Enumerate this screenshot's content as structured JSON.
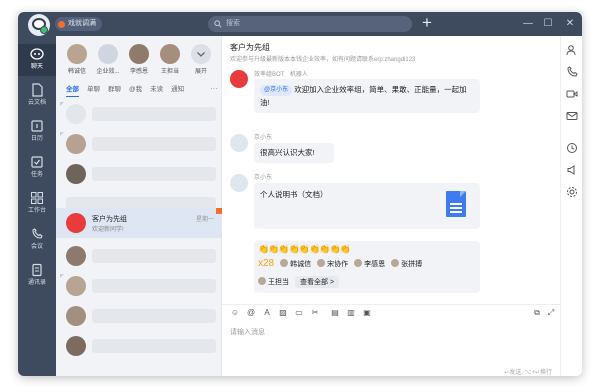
{
  "titlebar": {
    "status_label": "戏就调满",
    "search_placeholder": "搜索",
    "add_label": "+",
    "minimize": "—",
    "maximize": "☐",
    "close": "✕"
  },
  "rail": [
    {
      "label": "聊天",
      "icon": "chat-icon",
      "active": true
    },
    {
      "label": "云文档",
      "icon": "doc-icon"
    },
    {
      "label": "日历",
      "icon": "calendar-icon"
    },
    {
      "label": "任务",
      "icon": "task-icon"
    },
    {
      "label": "工作台",
      "icon": "workbench-icon"
    },
    {
      "label": "会议",
      "icon": "meeting-icon"
    },
    {
      "label": "通讯录",
      "icon": "contacts-icon"
    }
  ],
  "stories": [
    {
      "name": "韩诚信"
    },
    {
      "name": "企业效..."
    },
    {
      "name": "李感恩"
    },
    {
      "name": "王担当"
    },
    {
      "name": "展开"
    }
  ],
  "tabs": [
    "全部",
    "单聊",
    "群聊",
    "@我",
    "未读",
    "通知"
  ],
  "tabs_more": "···",
  "selected_conversation": {
    "title": "客户为先组",
    "subtitle": "欢迎新同学!",
    "time": "星期一"
  },
  "chat": {
    "title": "客户为先组",
    "subtitle": "欢迎参与升级最新版本本钱企业效率，如有问题请联系erp:zhangdi123",
    "messages": {
      "bot_sender": "效率组BOT",
      "bot_tag_role": "机器人",
      "bot_mention": "@京小东",
      "bot_text": "欢迎加入企业效率组，简单、果敢、正能量，一起加油!",
      "m2_sender": "京小东",
      "m2_text": "很高兴认识大家!",
      "m3_sender": "京小东",
      "m3_text": "个人说明书（文档）",
      "reactions": "👏👏👏👏👏👏👏👏👏",
      "reaction_count": "x28",
      "reactors": [
        "韩诚信",
        "宋协作",
        "李感恩",
        "张拼搏",
        "王担当"
      ],
      "view_all": "查看全部 >"
    },
    "input_placeholder": "请输入消息",
    "send_hint": "↵发送, ⌥+↵换行"
  },
  "colors": {
    "titlebar": "#3e4a5e",
    "accent": "#2a6ef0",
    "doc": "#3c7bf0"
  }
}
